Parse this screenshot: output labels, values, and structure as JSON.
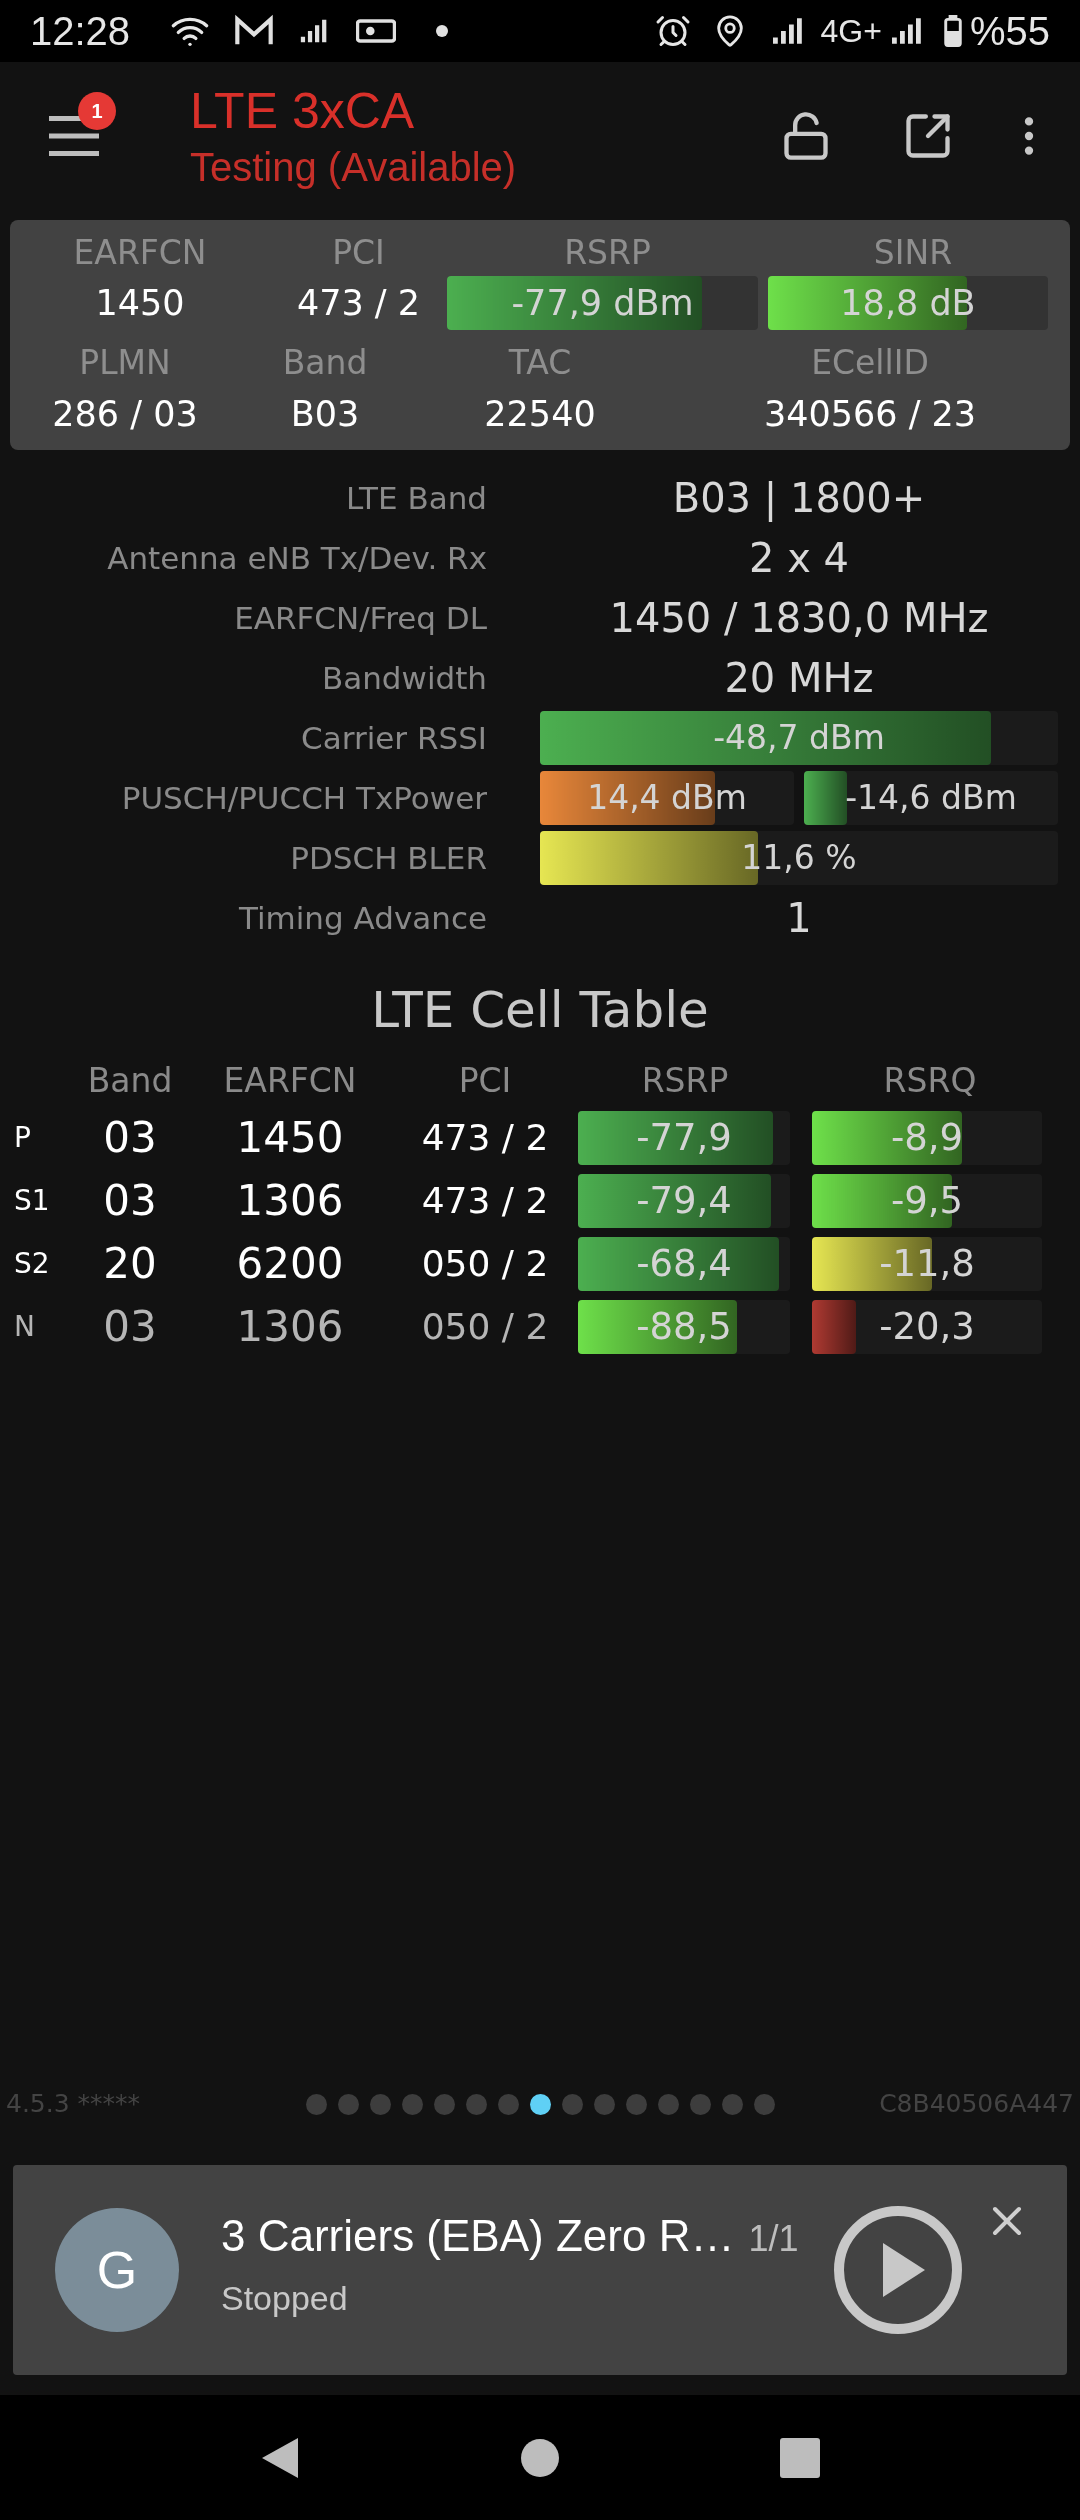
{
  "status_bar": {
    "time": "12:28",
    "network": "4G+",
    "battery": "%55"
  },
  "header": {
    "title": "LTE 3xCA",
    "subtitle": "Testing (Available)",
    "menu_badge": "1"
  },
  "summary": {
    "top": [
      {
        "kind": "text",
        "label": "EARFCN",
        "value": "1450"
      },
      {
        "kind": "text",
        "label": "PCI",
        "value": "473 / 2"
      },
      {
        "kind": "bar",
        "label": "RSRP",
        "value": "-77,9 dBm",
        "level": 0.82,
        "color": "#4caf50"
      },
      {
        "kind": "bar",
        "label": "SINR",
        "value": "18,8 dB",
        "level": 0.71,
        "color": "#6ee04a"
      }
    ],
    "bottom": [
      {
        "label": "PLMN",
        "value": "286 / 03"
      },
      {
        "label": "Band",
        "value": "B03"
      },
      {
        "label": "TAC",
        "value": "22540"
      },
      {
        "label": "ECellID",
        "value": "340566 / 23"
      }
    ]
  },
  "details": [
    {
      "kind": "text",
      "label": "LTE Band",
      "value": "B03 | 1800+"
    },
    {
      "kind": "text",
      "label": "Antenna eNB Tx/Dev. Rx",
      "value": "2 x 4"
    },
    {
      "kind": "text",
      "label": "EARFCN/Freq DL",
      "value": "1450 / 1830,0 MHz"
    },
    {
      "kind": "text",
      "label": "Bandwidth",
      "value": "20 MHz"
    },
    {
      "kind": "bars",
      "label": "Carrier RSSI",
      "bars": [
        {
          "value": "-48,7 dBm",
          "level": 0.87,
          "color": "#4caf50"
        }
      ]
    },
    {
      "kind": "bars",
      "label": "PUSCH/PUCCH TxPower",
      "bars": [
        {
          "value": "14,4 dBm",
          "level": 0.69,
          "color": "#e8873a"
        },
        {
          "value": "-14,6 dBm",
          "level": 0.17,
          "color": "#4caf50"
        }
      ]
    },
    {
      "kind": "bars",
      "label": "PDSCH BLER",
      "bars": [
        {
          "value": "11,6 %",
          "level": 0.42,
          "color": "#e6e652"
        }
      ]
    },
    {
      "kind": "text",
      "label": "Timing Advance",
      "value": "1"
    }
  ],
  "cell_table": {
    "title": "LTE Cell Table",
    "columns": [
      "Band",
      "EARFCN",
      "PCI",
      "RSRP",
      "RSRQ"
    ],
    "rows": [
      {
        "type": "P",
        "band": "03",
        "earfcn": "1450",
        "pci": "473 / 2",
        "dimmed": false,
        "rsrp": {
          "value": "-77,9",
          "level": 0.92,
          "color": "#4caf50"
        },
        "rsrq": {
          "value": "-8,9",
          "level": 0.65,
          "color": "#6ee04a"
        }
      },
      {
        "type": "S1",
        "band": "03",
        "earfcn": "1306",
        "pci": "473 / 2",
        "dimmed": false,
        "rsrp": {
          "value": "-79,4",
          "level": 0.91,
          "color": "#4caf50"
        },
        "rsrq": {
          "value": "-9,5",
          "level": 0.61,
          "color": "#6ee04a"
        }
      },
      {
        "type": "S2",
        "band": "20",
        "earfcn": "6200",
        "pci": "050 / 2",
        "dimmed": false,
        "rsrp": {
          "value": "-68,4",
          "level": 0.95,
          "color": "#4caf50"
        },
        "rsrq": {
          "value": "-11,8",
          "level": 0.52,
          "color": "#e6e652"
        }
      },
      {
        "type": "N",
        "band": "03",
        "earfcn": "1306",
        "pci": "050 / 2",
        "dimmed": true,
        "rsrp": {
          "value": "-88,5",
          "level": 0.75,
          "color": "#6ee04a"
        },
        "rsrq": {
          "value": "-20,3",
          "level": 0.19,
          "color": "#b03a32"
        }
      }
    ]
  },
  "footer": {
    "version": "4.5.3 *****",
    "device_id": "C8B40506A447",
    "pages": [
      {
        "selected": false
      },
      {
        "selected": false
      },
      {
        "selected": false
      },
      {
        "selected": false
      },
      {
        "selected": false
      },
      {
        "selected": false
      },
      {
        "selected": false
      },
      {
        "selected": true
      },
      {
        "selected": false
      },
      {
        "selected": false
      },
      {
        "selected": false
      },
      {
        "selected": false
      },
      {
        "selected": false
      },
      {
        "selected": false
      },
      {
        "selected": false
      }
    ]
  },
  "notification": {
    "avatar": "G",
    "title": "3 Carriers (EBA) Zero R…",
    "count": "1/1",
    "status": "Stopped"
  }
}
